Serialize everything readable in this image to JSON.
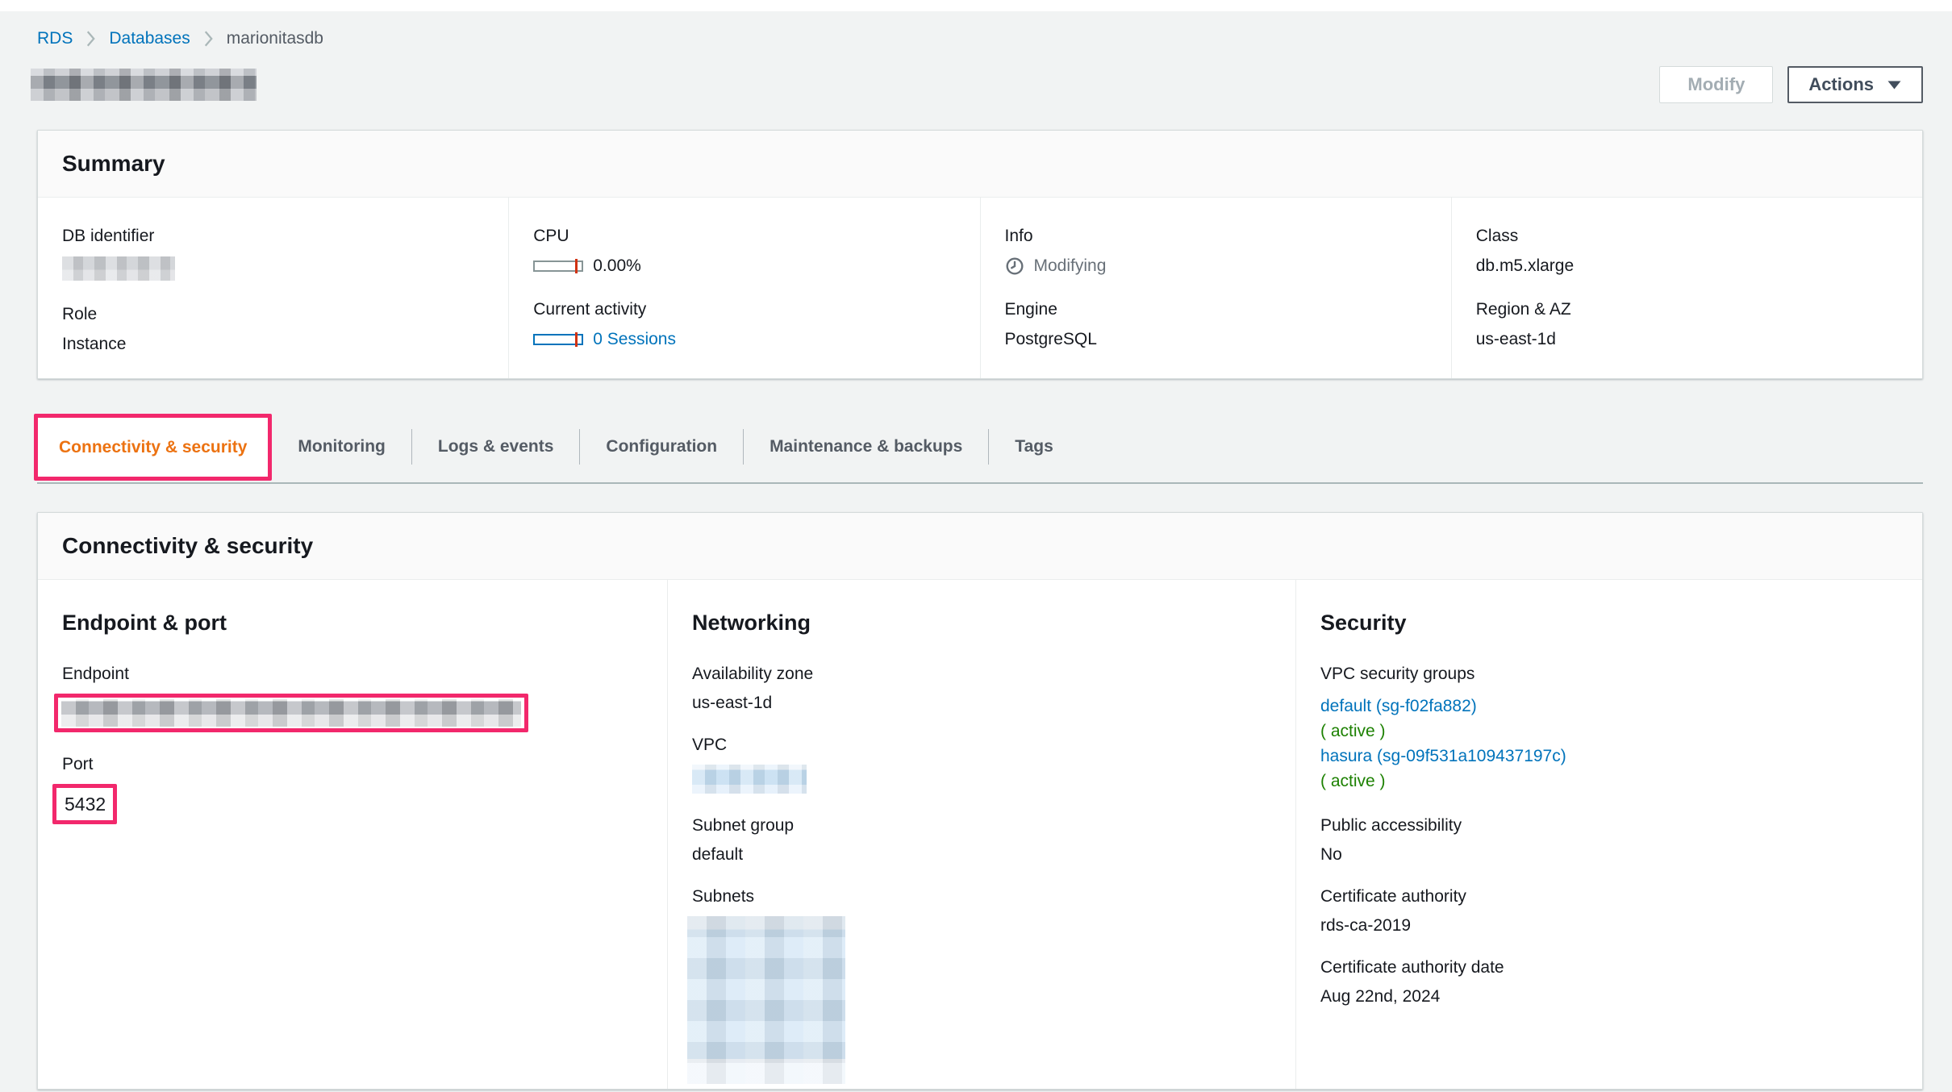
{
  "colors": {
    "link_blue": "#0073bb",
    "active_tab_orange": "#ec7211",
    "status_green": "#1d8102",
    "annotation_pink": "#f2286c",
    "muted_gray": "#687078",
    "alarm_red": "#d13212",
    "page_background": "#f1f3f3"
  },
  "breadcrumb": {
    "items": [
      {
        "label": "RDS"
      },
      {
        "label": "Databases"
      },
      {
        "label": "marionitasdb"
      }
    ]
  },
  "header": {
    "modify_label": "Modify",
    "actions_label": "Actions"
  },
  "summary": {
    "title": "Summary",
    "db_identifier_label": "DB identifier",
    "role_label": "Role",
    "role_value": "Instance",
    "cpu_label": "CPU",
    "cpu_value": "0.00%",
    "activity_label": "Current activity",
    "activity_value": "0 Sessions",
    "info_label": "Info",
    "info_value": "Modifying",
    "engine_label": "Engine",
    "engine_value": "PostgreSQL",
    "class_label": "Class",
    "class_value": "db.m5.xlarge",
    "region_label": "Region & AZ",
    "region_value": "us-east-1d"
  },
  "tabs": {
    "active_index": 0,
    "items": [
      {
        "label": "Connectivity & security"
      },
      {
        "label": "Monitoring"
      },
      {
        "label": "Logs & events"
      },
      {
        "label": "Configuration"
      },
      {
        "label": "Maintenance & backups"
      },
      {
        "label": "Tags"
      }
    ]
  },
  "connectivity": {
    "title": "Connectivity & security",
    "endpoint_port": {
      "title": "Endpoint & port",
      "endpoint_label": "Endpoint",
      "port_label": "Port",
      "port_value": "5432"
    },
    "networking": {
      "title": "Networking",
      "az_label": "Availability zone",
      "az_value": "us-east-1d",
      "vpc_label": "VPC",
      "subnet_group_label": "Subnet group",
      "subnet_group_value": "default",
      "subnets_label": "Subnets"
    },
    "security": {
      "title": "Security",
      "vpc_sg_label": "VPC security groups",
      "groups": [
        {
          "link": "default (sg-f02fa882)",
          "status": "( active )"
        },
        {
          "link": "hasura (sg-09f531a109437197c)",
          "status": "( active )"
        }
      ],
      "public_label": "Public accessibility",
      "public_value": "No",
      "ca_label": "Certificate authority",
      "ca_value": "rds-ca-2019",
      "ca_date_label": "Certificate authority date",
      "ca_date_value": "Aug 22nd, 2024"
    }
  }
}
